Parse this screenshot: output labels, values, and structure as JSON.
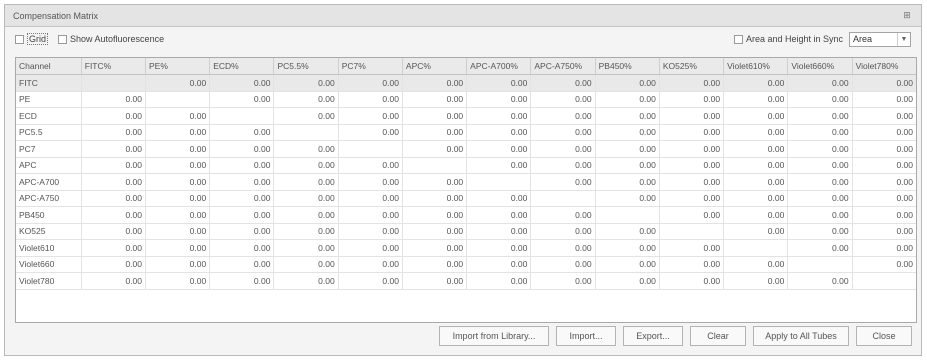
{
  "window": {
    "title": "Compensation Matrix"
  },
  "options": {
    "grid_label": "Grid",
    "show_autofluorescence_label": "Show Autofluorescence",
    "sync_label": "Area and Height in Sync",
    "sync_select_value": "Area"
  },
  "table": {
    "headers": [
      "Channel",
      "FITC%",
      "PE%",
      "ECD%",
      "PC5.5%",
      "PC7%",
      "APC%",
      "APC-A700%",
      "APC-A750%",
      "PB450%",
      "KO525%",
      "Violet610%",
      "Violet660%",
      "Violet780%"
    ],
    "rows": [
      [
        "FITC",
        "",
        "0.00",
        "0.00",
        "0.00",
        "0.00",
        "0.00",
        "0.00",
        "0.00",
        "0.00",
        "0.00",
        "0.00",
        "0.00",
        "0.00"
      ],
      [
        "PE",
        "0.00",
        "",
        "0.00",
        "0.00",
        "0.00",
        "0.00",
        "0.00",
        "0.00",
        "0.00",
        "0.00",
        "0.00",
        "0.00",
        "0.00"
      ],
      [
        "ECD",
        "0.00",
        "0.00",
        "",
        "0.00",
        "0.00",
        "0.00",
        "0.00",
        "0.00",
        "0.00",
        "0.00",
        "0.00",
        "0.00",
        "0.00"
      ],
      [
        "PC5.5",
        "0.00",
        "0.00",
        "0.00",
        "",
        "0.00",
        "0.00",
        "0.00",
        "0.00",
        "0.00",
        "0.00",
        "0.00",
        "0.00",
        "0.00"
      ],
      [
        "PC7",
        "0.00",
        "0.00",
        "0.00",
        "0.00",
        "",
        "0.00",
        "0.00",
        "0.00",
        "0.00",
        "0.00",
        "0.00",
        "0.00",
        "0.00"
      ],
      [
        "APC",
        "0.00",
        "0.00",
        "0.00",
        "0.00",
        "0.00",
        "",
        "0.00",
        "0.00",
        "0.00",
        "0.00",
        "0.00",
        "0.00",
        "0.00"
      ],
      [
        "APC-A700",
        "0.00",
        "0.00",
        "0.00",
        "0.00",
        "0.00",
        "0.00",
        "",
        "0.00",
        "0.00",
        "0.00",
        "0.00",
        "0.00",
        "0.00"
      ],
      [
        "APC-A750",
        "0.00",
        "0.00",
        "0.00",
        "0.00",
        "0.00",
        "0.00",
        "0.00",
        "",
        "0.00",
        "0.00",
        "0.00",
        "0.00",
        "0.00"
      ],
      [
        "PB450",
        "0.00",
        "0.00",
        "0.00",
        "0.00",
        "0.00",
        "0.00",
        "0.00",
        "0.00",
        "",
        "0.00",
        "0.00",
        "0.00",
        "0.00"
      ],
      [
        "KO525",
        "0.00",
        "0.00",
        "0.00",
        "0.00",
        "0.00",
        "0.00",
        "0.00",
        "0.00",
        "0.00",
        "",
        "0.00",
        "0.00",
        "0.00"
      ],
      [
        "Violet610",
        "0.00",
        "0.00",
        "0.00",
        "0.00",
        "0.00",
        "0.00",
        "0.00",
        "0.00",
        "0.00",
        "0.00",
        "",
        "0.00",
        "0.00"
      ],
      [
        "Violet660",
        "0.00",
        "0.00",
        "0.00",
        "0.00",
        "0.00",
        "0.00",
        "0.00",
        "0.00",
        "0.00",
        "0.00",
        "0.00",
        "",
        "0.00"
      ],
      [
        "Violet780",
        "0.00",
        "0.00",
        "0.00",
        "0.00",
        "0.00",
        "0.00",
        "0.00",
        "0.00",
        "0.00",
        "0.00",
        "0.00",
        "0.00",
        ""
      ]
    ]
  },
  "buttons": {
    "import_library": "Import from Library...",
    "import": "Import...",
    "export": "Export...",
    "clear": "Clear",
    "apply_all": "Apply to All Tubes",
    "close": "Close"
  },
  "icons": {
    "pin": "pin-icon",
    "dropdown": "chevron-down-icon"
  }
}
